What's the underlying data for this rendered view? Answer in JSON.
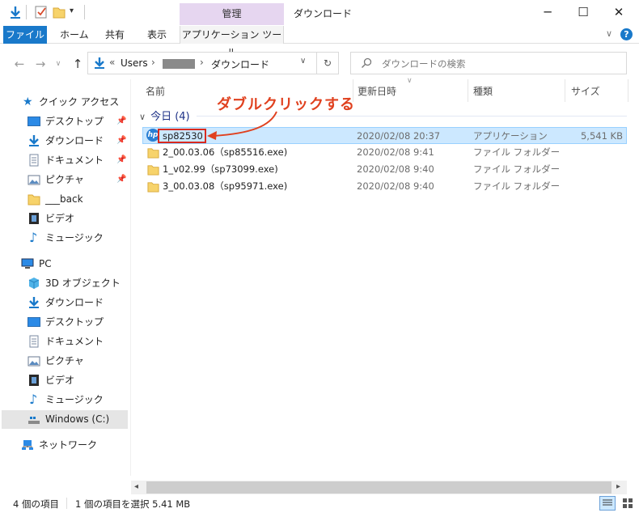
{
  "window": {
    "title": "ダウンロード",
    "context_group": "管理",
    "controls": {
      "minimize": "─",
      "maximize": "☐",
      "close": "✕"
    }
  },
  "ribbon": {
    "tabs": [
      "ファイル",
      "ホーム",
      "共有",
      "表示",
      "アプリケーション ツール"
    ]
  },
  "address": {
    "back": "←",
    "forward": "→",
    "up": "↑",
    "overflow": "«",
    "crumbs": [
      "Users",
      "ダウンロード"
    ],
    "search_placeholder": "ダウンロードの検索"
  },
  "sidebar": {
    "quick_access": "クイック アクセス",
    "quick_items": [
      "デスクトップ",
      "ダウンロード",
      "ドキュメント",
      "ピクチャ",
      "___back",
      "ビデオ",
      "ミュージック"
    ],
    "pc": "PC",
    "pc_items": [
      "3D オブジェクト",
      "ダウンロード",
      "デスクトップ",
      "ドキュメント",
      "ピクチャ",
      "ビデオ",
      "ミュージック",
      "Windows (C:)"
    ],
    "network": "ネットワーク",
    "pin": "📌"
  },
  "columns": {
    "name": "名前",
    "date": "更新日時",
    "type": "種類",
    "size": "サイズ"
  },
  "group": {
    "label": "今日 (4)",
    "chevron": "∨"
  },
  "files": [
    {
      "name": "sp82530",
      "date": "2020/02/08 20:37",
      "type": "アプリケーション",
      "size": "5,541 KB",
      "icon": "hp-app-icon"
    },
    {
      "name": "2_00.03.06（sp85516.exe)",
      "date": "2020/02/08 9:41",
      "type": "ファイル フォルダー",
      "size": "",
      "icon": "folder-icon"
    },
    {
      "name": "1_v02.99（sp73099.exe)",
      "date": "2020/02/08 9:40",
      "type": "ファイル フォルダー",
      "size": "",
      "icon": "folder-icon"
    },
    {
      "name": "3_00.03.08（sp95971.exe)",
      "date": "2020/02/08 9:40",
      "type": "ファイル フォルダー",
      "size": "",
      "icon": "folder-icon"
    }
  ],
  "annotation": {
    "text": "ダブルクリックする",
    "color": "#e0411f"
  },
  "status": {
    "count": "4 個の項目",
    "selected": "1 個の項目を選択  5.41 MB"
  },
  "colors": {
    "accent": "#1979ca",
    "selection": "#cce8ff",
    "context_tab": "#e6d6f0"
  }
}
